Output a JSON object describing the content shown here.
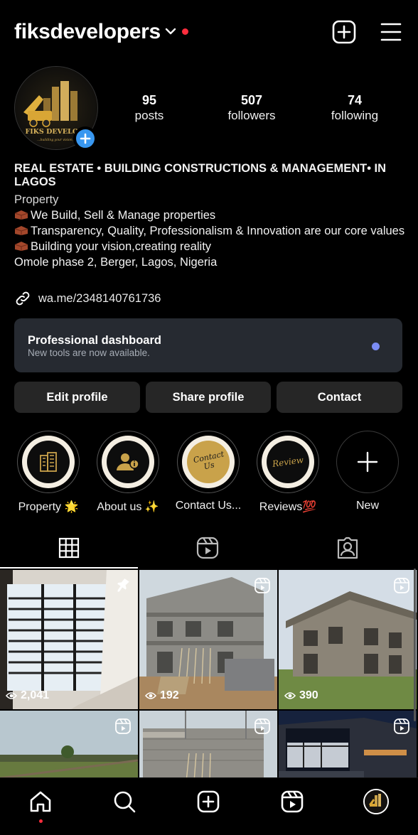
{
  "header": {
    "username": "fiksdevelopers"
  },
  "profile": {
    "avatar_text": "FIKS DEVELOPE",
    "avatar_tagline": "...building your vision, creati",
    "stats": [
      {
        "num": "95",
        "label": "posts"
      },
      {
        "num": "507",
        "label": "followers"
      },
      {
        "num": "74",
        "label": "following"
      }
    ]
  },
  "bio": {
    "headline": "REAL ESTATE • BUILDING CONSTRUCTIONS & MANAGEMENT• IN LAGOS",
    "category": "Property",
    "line1": "We Build, Sell & Manage properties",
    "line2": "Transparency, Quality, Professionalism & Innovation are our core values",
    "line3": "Building your vision,creating reality",
    "address": "Omole phase 2, Berger, Lagos, Nigeria",
    "link": "wa.me/2348140761736"
  },
  "dashboard": {
    "title": "Professional dashboard",
    "subtitle": "New tools are now available."
  },
  "buttons": {
    "edit": "Edit profile",
    "share": "Share profile",
    "contact": "Contact"
  },
  "highlights": [
    {
      "label": "Property 🌟",
      "cover_text": ""
    },
    {
      "label": "About us ✨",
      "cover_text": ""
    },
    {
      "label": "Contact Us...",
      "cover_text": "Contact Us"
    },
    {
      "label": "Reviews💯",
      "cover_text": "Review"
    },
    {
      "label": "New",
      "cover_text": ""
    }
  ],
  "grid": {
    "posts": [
      {
        "views": "2,041",
        "pinned": true,
        "reel": false
      },
      {
        "views": "192",
        "pinned": false,
        "reel": true
      },
      {
        "views": "390",
        "pinned": false,
        "reel": true
      },
      {
        "views": "",
        "pinned": false,
        "reel": true
      },
      {
        "views": "",
        "pinned": false,
        "reel": true
      },
      {
        "views": "",
        "pinned": false,
        "reel": true
      }
    ]
  },
  "colors": {
    "background": "#000000",
    "surface": "#262626",
    "dashboard": "#262a31",
    "accent_blue": "#3897f0",
    "notification_red": "#ff2d3d",
    "dashboard_dot": "#7b8cf4",
    "highlight_ring": "#f4eee2",
    "gold": "#c9a24a"
  },
  "icons": {
    "top": [
      "chevron-down-icon",
      "new-post-icon",
      "menu-icon"
    ],
    "tabs": [
      "grid-icon",
      "reels-icon",
      "tagged-icon"
    ],
    "nav": [
      "home-icon",
      "search-icon",
      "create-icon",
      "reels-icon",
      "profile-avatar"
    ]
  }
}
